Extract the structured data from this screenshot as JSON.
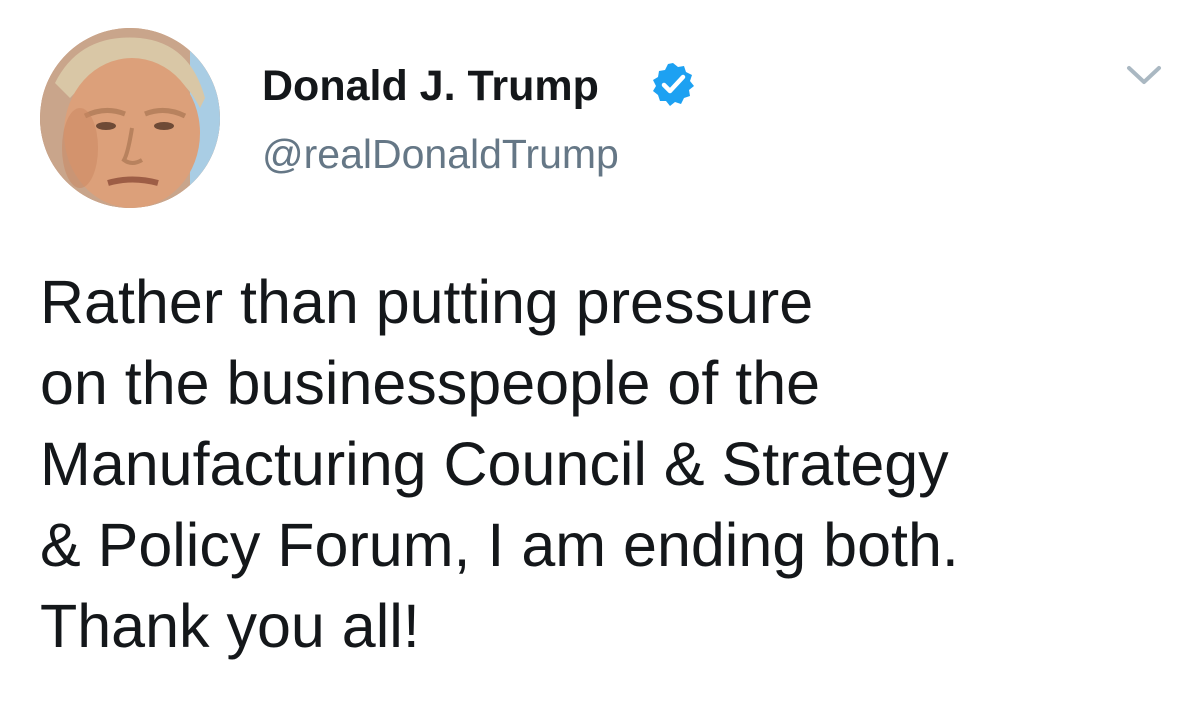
{
  "tweet": {
    "author": {
      "display_name": "Donald J. Trump",
      "handle": "@realDonaldTrump",
      "verified": true,
      "avatar_icon": "profile-photo"
    },
    "menu_icon": "chevron-down-icon",
    "text": "Rather than putting pressure\non the businesspeople of the\nManufacturing Council & Strategy\n& Policy Forum, I am ending both.\nThank you all!"
  },
  "colors": {
    "text": "#14171a",
    "secondary_text": "#657786",
    "verified_badge": "#1da1f2",
    "chevron": "#aab8c2",
    "background": "#ffffff"
  }
}
